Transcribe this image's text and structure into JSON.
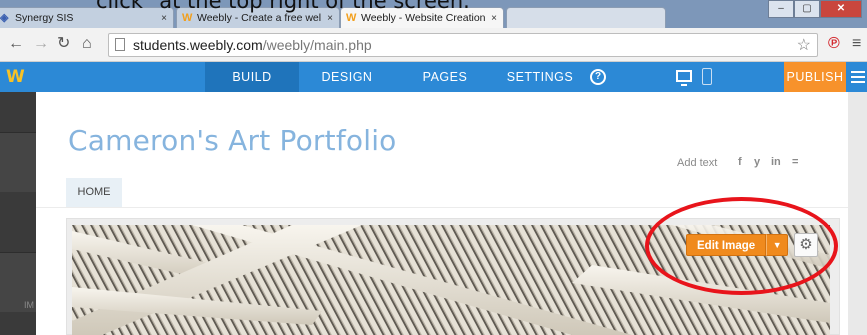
{
  "caption": "click \"at the top right of the screen.",
  "browser": {
    "tabs": [
      {
        "title": "Synergy SIS",
        "favicon": "synergy-icon"
      },
      {
        "title": "Weebly - Create a free wel",
        "favicon": "weebly-icon"
      },
      {
        "title": "Weebly - Website Creation",
        "favicon": "weebly-icon"
      },
      {
        "title": "",
        "favicon": ""
      }
    ],
    "tab_close": "×",
    "window_buttons": [
      "–",
      "▢",
      "✕"
    ],
    "url_host": "students.weebly.com",
    "url_path": "/weebly/main.php"
  },
  "weebly": {
    "logo": "W",
    "nav": [
      "BUILD",
      "DESIGN",
      "PAGES",
      "SETTINGS"
    ],
    "help": "?",
    "publish": "PUBLISH"
  },
  "site": {
    "title": "Cameron's Art Portfolio",
    "add_text": "Add text",
    "social": [
      "f",
      "y",
      "in",
      "="
    ],
    "nav_item": "HOME"
  },
  "image_block": {
    "edit_label": "Edit Image",
    "left_panel_label": "IM"
  },
  "colors": {
    "weebly_blue": "#2c89d6",
    "publish_orange": "#f7922b",
    "edit_orange": "#f08a1d",
    "title_blue": "#86b4de",
    "annotation_red": "#e8141b"
  }
}
